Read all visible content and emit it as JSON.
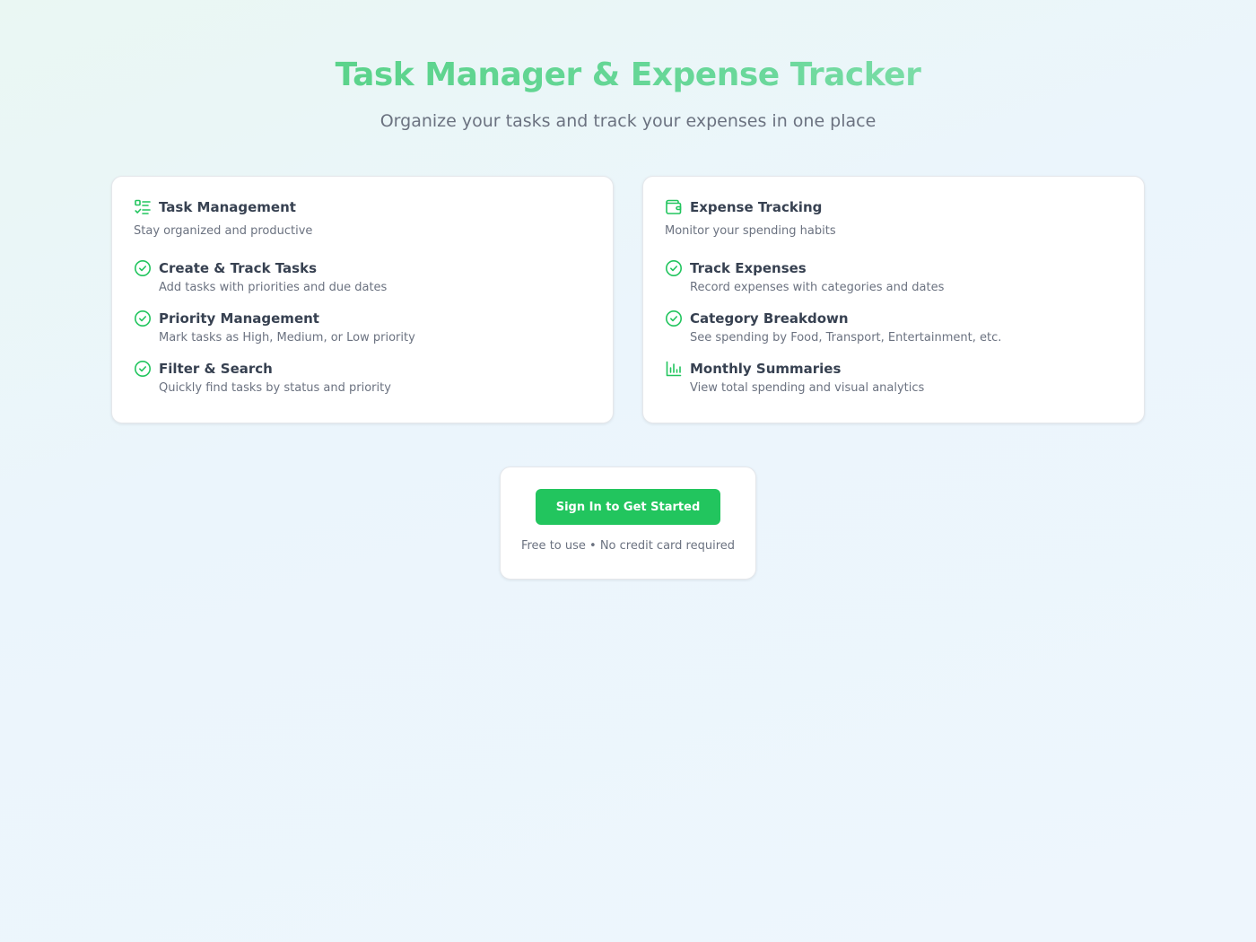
{
  "hero": {
    "title": "Task Manager & Expense Tracker",
    "subtitle": "Organize your tasks and track your expenses in one place"
  },
  "task_card": {
    "icon": "task-list-icon",
    "title": "Task Management",
    "subtitle": "Stay organized and productive",
    "features": [
      {
        "icon": "check-circle-icon",
        "title": "Create & Track Tasks",
        "desc": "Add tasks with priorities and due dates"
      },
      {
        "icon": "check-circle-icon",
        "title": "Priority Management",
        "desc": "Mark tasks as High, Medium, or Low priority"
      },
      {
        "icon": "check-circle-icon",
        "title": "Filter & Search",
        "desc": "Quickly find tasks by status and priority"
      }
    ]
  },
  "expense_card": {
    "icon": "wallet-icon",
    "title": "Expense Tracking",
    "subtitle": "Monitor your spending habits",
    "features": [
      {
        "icon": "check-circle-icon",
        "title": "Track Expenses",
        "desc": "Record expenses with categories and dates"
      },
      {
        "icon": "check-circle-icon",
        "title": "Category Breakdown",
        "desc": "See spending by Food, Transport, Entertainment, etc."
      },
      {
        "icon": "bar-chart-icon",
        "title": "Monthly Summaries",
        "desc": "View total spending and visual analytics"
      }
    ]
  },
  "cta": {
    "button_label": "Sign In to Get Started",
    "note": "Free to use • No credit card required"
  },
  "colors": {
    "accent": "#22c55e",
    "title_gradient_start": "#4fcf7e",
    "title_gradient_end": "#9ae6bd"
  }
}
